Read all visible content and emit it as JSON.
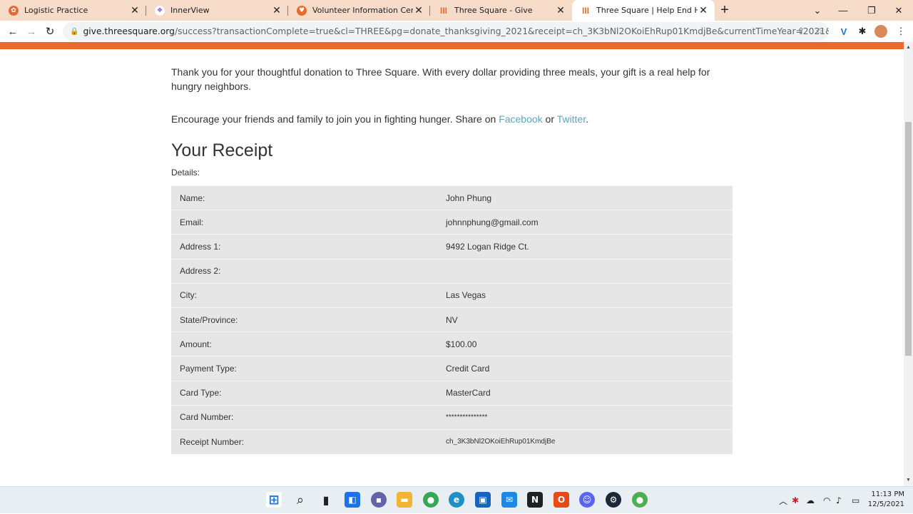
{
  "browser": {
    "tabs": [
      {
        "title": "Logistic Practice",
        "icon": "logistic-favicon",
        "color": "#e06b3b"
      },
      {
        "title": "InnerView",
        "icon": "innerview-favicon",
        "color": "#6b5bd6"
      },
      {
        "title": "Volunteer Information Center",
        "icon": "vic-favicon",
        "color": "#e8692a"
      },
      {
        "title": "Three Square - Give",
        "icon": "threesquare-favicon",
        "color": "#e8692a"
      },
      {
        "title": "Three Square | Help End Hunger",
        "icon": "threesquare-favicon",
        "color": "#e8692a"
      }
    ],
    "url_domain": "give.threesquare.org",
    "url_rest": "/success?transactionComplete=true&cl=THREE&pg=donate_thanksgiving_2021&receipt=ch_3K3bNl2OKoiEhRup01KmdjBe&currentTimeYear=2021&currentTimeMonth=..."
  },
  "page": {
    "thank_you": "Thank you for your thoughtful donation to Three Square. With every dollar providing three meals, your gift is a real help for hungry neighbors.",
    "share_prefix": "Encourage your friends and family to join you in fighting hunger. Share on ",
    "facebook": "Facebook",
    "or": " or ",
    "twitter": "Twitter",
    "period": ".",
    "receipt_title": "Your Receipt",
    "details_label": "Details:",
    "rows": [
      {
        "label": "Name:",
        "value": "John Phung"
      },
      {
        "label": "Email:",
        "value": "johnnphung@gmail.com"
      },
      {
        "label": "Address 1:",
        "value": "9492 Logan Ridge Ct."
      },
      {
        "label": "Address 2:",
        "value": ""
      },
      {
        "label": "City:",
        "value": "Las Vegas"
      },
      {
        "label": "State/Province:",
        "value": "NV"
      },
      {
        "label": "Amount:",
        "value": "$100.00"
      },
      {
        "label": "Payment Type:",
        "value": "Credit Card"
      },
      {
        "label": "Card Type:",
        "value": "MasterCard"
      },
      {
        "label": "Card Number:",
        "value": "***************"
      },
      {
        "label": "Receipt Number:",
        "value": "ch_3K3bNl2OKoiEhRup01KmdjBe"
      }
    ]
  },
  "taskbar": {
    "time": "11:13 PM",
    "date": "12/5/2021"
  },
  "colors": {
    "accent": "#e8692a",
    "link": "#5ba8c3"
  }
}
